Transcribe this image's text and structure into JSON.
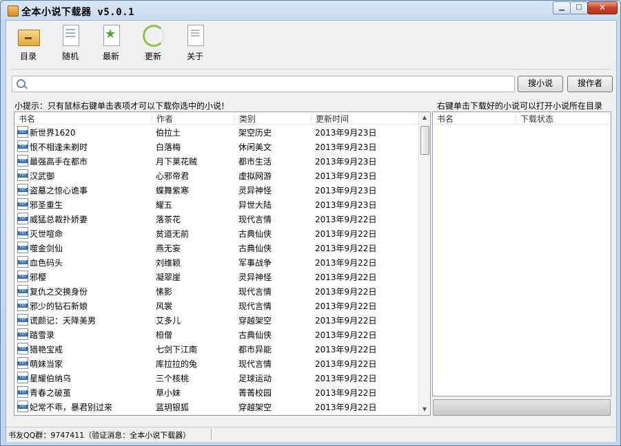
{
  "window": {
    "title": "全本小说下载器 v5.0.1"
  },
  "toolbar": [
    {
      "label": "目录",
      "icon": "catalog-icon"
    },
    {
      "label": "随机",
      "icon": "random-icon"
    },
    {
      "label": "最新",
      "icon": "latest-icon"
    },
    {
      "label": "更新",
      "icon": "update-icon"
    },
    {
      "label": "关于",
      "icon": "about-icon"
    }
  ],
  "search": {
    "value": "",
    "placeholder": "",
    "btn_novel": "搜小说",
    "btn_author": "搜作者"
  },
  "tips": {
    "left": "小提示：只有鼠标右键单击表项才可以下载你选中的小说!",
    "right": "右键单击下载好的小说可以打开小说所在目录"
  },
  "novel_table": {
    "headers": [
      "书名",
      "作者",
      "类别",
      "更新时间"
    ],
    "rows": [
      [
        "新世界1620",
        "伯拉土",
        "架空历史",
        "2013年9月23日"
      ],
      [
        "恨不相逢未剃时",
        "白落梅",
        "休闲美文",
        "2013年9月23日"
      ],
      [
        "最强高手在都市",
        "月下莱花贼",
        "都市生活",
        "2013年9月23日"
      ],
      [
        "汉武御",
        "心邪帝君",
        "虚拟网游",
        "2013年9月23日"
      ],
      [
        "盗墓之惊心诡事",
        "蝶舞紫寒",
        "灵异神怪",
        "2013年9月23日"
      ],
      [
        "邪圣重生",
        "耀五",
        "异世大陆",
        "2013年9月23日"
      ],
      [
        "威猛总裁扑娇妻",
        "落茶花",
        "现代言情",
        "2013年9月22日"
      ],
      [
        "灭世喧命",
        "贫道无前",
        "古典仙侠",
        "2013年9月22日"
      ],
      [
        "噬金剑仙",
        "燕无妄",
        "古典仙侠",
        "2013年9月22日"
      ],
      [
        "血色码头",
        "刘维颖",
        "军事战争",
        "2013年9月22日"
      ],
      [
        "邪樱",
        "凝翠崖",
        "灵异神怪",
        "2013年9月22日"
      ],
      [
        "复仇之交换身份",
        "愫影",
        "现代言情",
        "2013年9月22日"
      ],
      [
        "邪少的钻石新娘",
        "风裳",
        "现代言情",
        "2013年9月22日"
      ],
      [
        "谎颜记：天降美男",
        "艾多儿",
        "穿越架空",
        "2013年9月22日"
      ],
      [
        "踏雪录",
        "桓僧",
        "古典仙侠",
        "2013年9月22日"
      ],
      [
        "猎艳宝戒",
        "七剑下江南",
        "都市异能",
        "2013年9月22日"
      ],
      [
        "萌妹当家",
        "库拉拉的兔",
        "现代言情",
        "2013年9月22日"
      ],
      [
        "星耀伯纳乌",
        "三个核桃",
        "足球运动",
        "2013年9月22日"
      ],
      [
        "青春之破茧",
        "草小妹",
        "菁菁校园",
        "2013年9月22日"
      ],
      [
        "妃常不乖，暴君别过来",
        "蓝玥银狐",
        "穿越架空",
        "2013年9月22日"
      ]
    ]
  },
  "download_table": {
    "headers": [
      "书名",
      "下载状态"
    ],
    "rows": []
  },
  "status": {
    "text": "书友QQ群：9747411（验证消息：全本小说下载器）"
  }
}
